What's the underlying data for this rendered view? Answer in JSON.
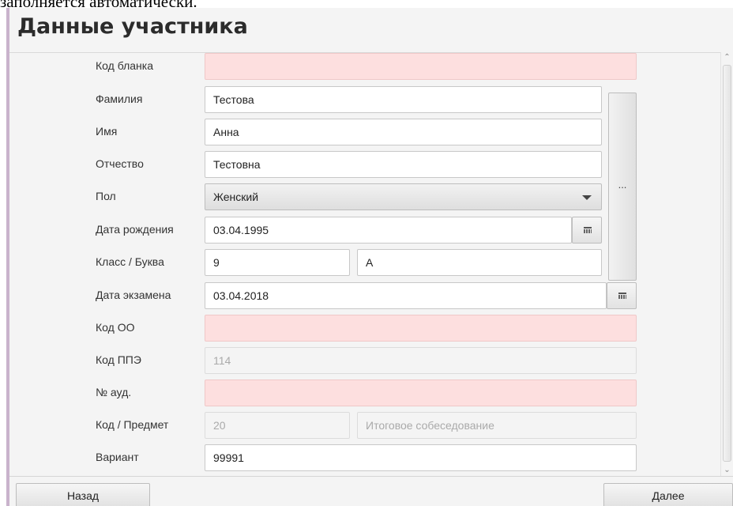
{
  "top_text": "заполняется автоматически.",
  "header": {
    "title": "Данные участника"
  },
  "form": {
    "blank_code": {
      "label": "Код бланка",
      "value": ""
    },
    "surname": {
      "label": "Фамилия",
      "value": "Тестова"
    },
    "name": {
      "label": "Имя",
      "value": "Анна"
    },
    "patronymic": {
      "label": "Отчество",
      "value": "Тестовна"
    },
    "gender": {
      "label": "Пол",
      "value": "Женский"
    },
    "birth_date": {
      "label": "Дата рождения",
      "value": "03.04.1995"
    },
    "class_letter": {
      "label": "Класс / Буква",
      "class_value": "9",
      "letter_value": "А"
    },
    "exam_date": {
      "label": "Дата экзамена",
      "value": "03.04.2018"
    },
    "oo_code": {
      "label": "Код ОО",
      "value": ""
    },
    "ppe_code": {
      "label": "Код ППЭ",
      "value": "114"
    },
    "auditorium": {
      "label": "№ ауд.",
      "value": ""
    },
    "subject": {
      "label": "Код / Предмет",
      "code_value": "20",
      "subject_value": "Итоговое собеседование"
    },
    "variant": {
      "label": "Вариант",
      "value": "99991"
    },
    "person_lookup_label": "..."
  },
  "footer": {
    "back_label": "Назад",
    "next_label": "Далее"
  },
  "icons": {
    "calendar": "calendar-icon",
    "dropdown": "chevron-down-icon",
    "scroll_up": "arrow-up-icon",
    "scroll_down": "arrow-down-icon"
  },
  "colors": {
    "required_field_bg": "#fddfdf",
    "window_bg": "#f4f4f4",
    "left_border": "#c9b3cc"
  }
}
